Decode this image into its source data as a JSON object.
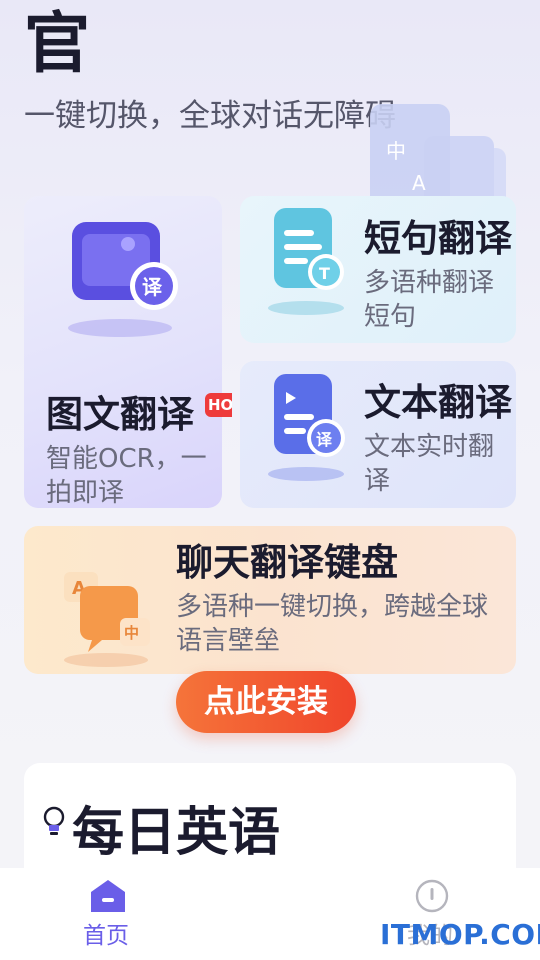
{
  "hero": {
    "title": "官",
    "subtitle": "一键切换，全球对话无障碍"
  },
  "features": {
    "image_translate": {
      "title": "图文翻译",
      "badge": "HOT",
      "desc": "智能OCR，一拍即译",
      "icon": "photo-translate-icon"
    },
    "short_translate": {
      "title": "短句翻译",
      "desc": "多语种翻译短句",
      "icon": "short-text-icon"
    },
    "text_translate": {
      "title": "文本翻译",
      "desc": "文本实时翻译",
      "icon": "document-translate-icon"
    },
    "chat_keyboard": {
      "title": "聊天翻译键盘",
      "desc": "多语种一键切换，跨越全球语言壁垒",
      "icon": "chat-bubbles-icon",
      "install_label": "点此安装"
    }
  },
  "daily_english": {
    "title": "每日英语",
    "icon": "lightbulb-icon"
  },
  "tabbar": {
    "tabs": [
      {
        "label": "首页",
        "active": true,
        "icon": "home-icon"
      },
      {
        "label": "我的",
        "active": false,
        "icon": "profile-icon"
      }
    ]
  },
  "watermark": "ITMOP.COM",
  "colors": {
    "accent": "#6a5ee8",
    "install_start": "#f5743a",
    "install_end": "#f0452b",
    "hot": "#ee3b3b"
  }
}
